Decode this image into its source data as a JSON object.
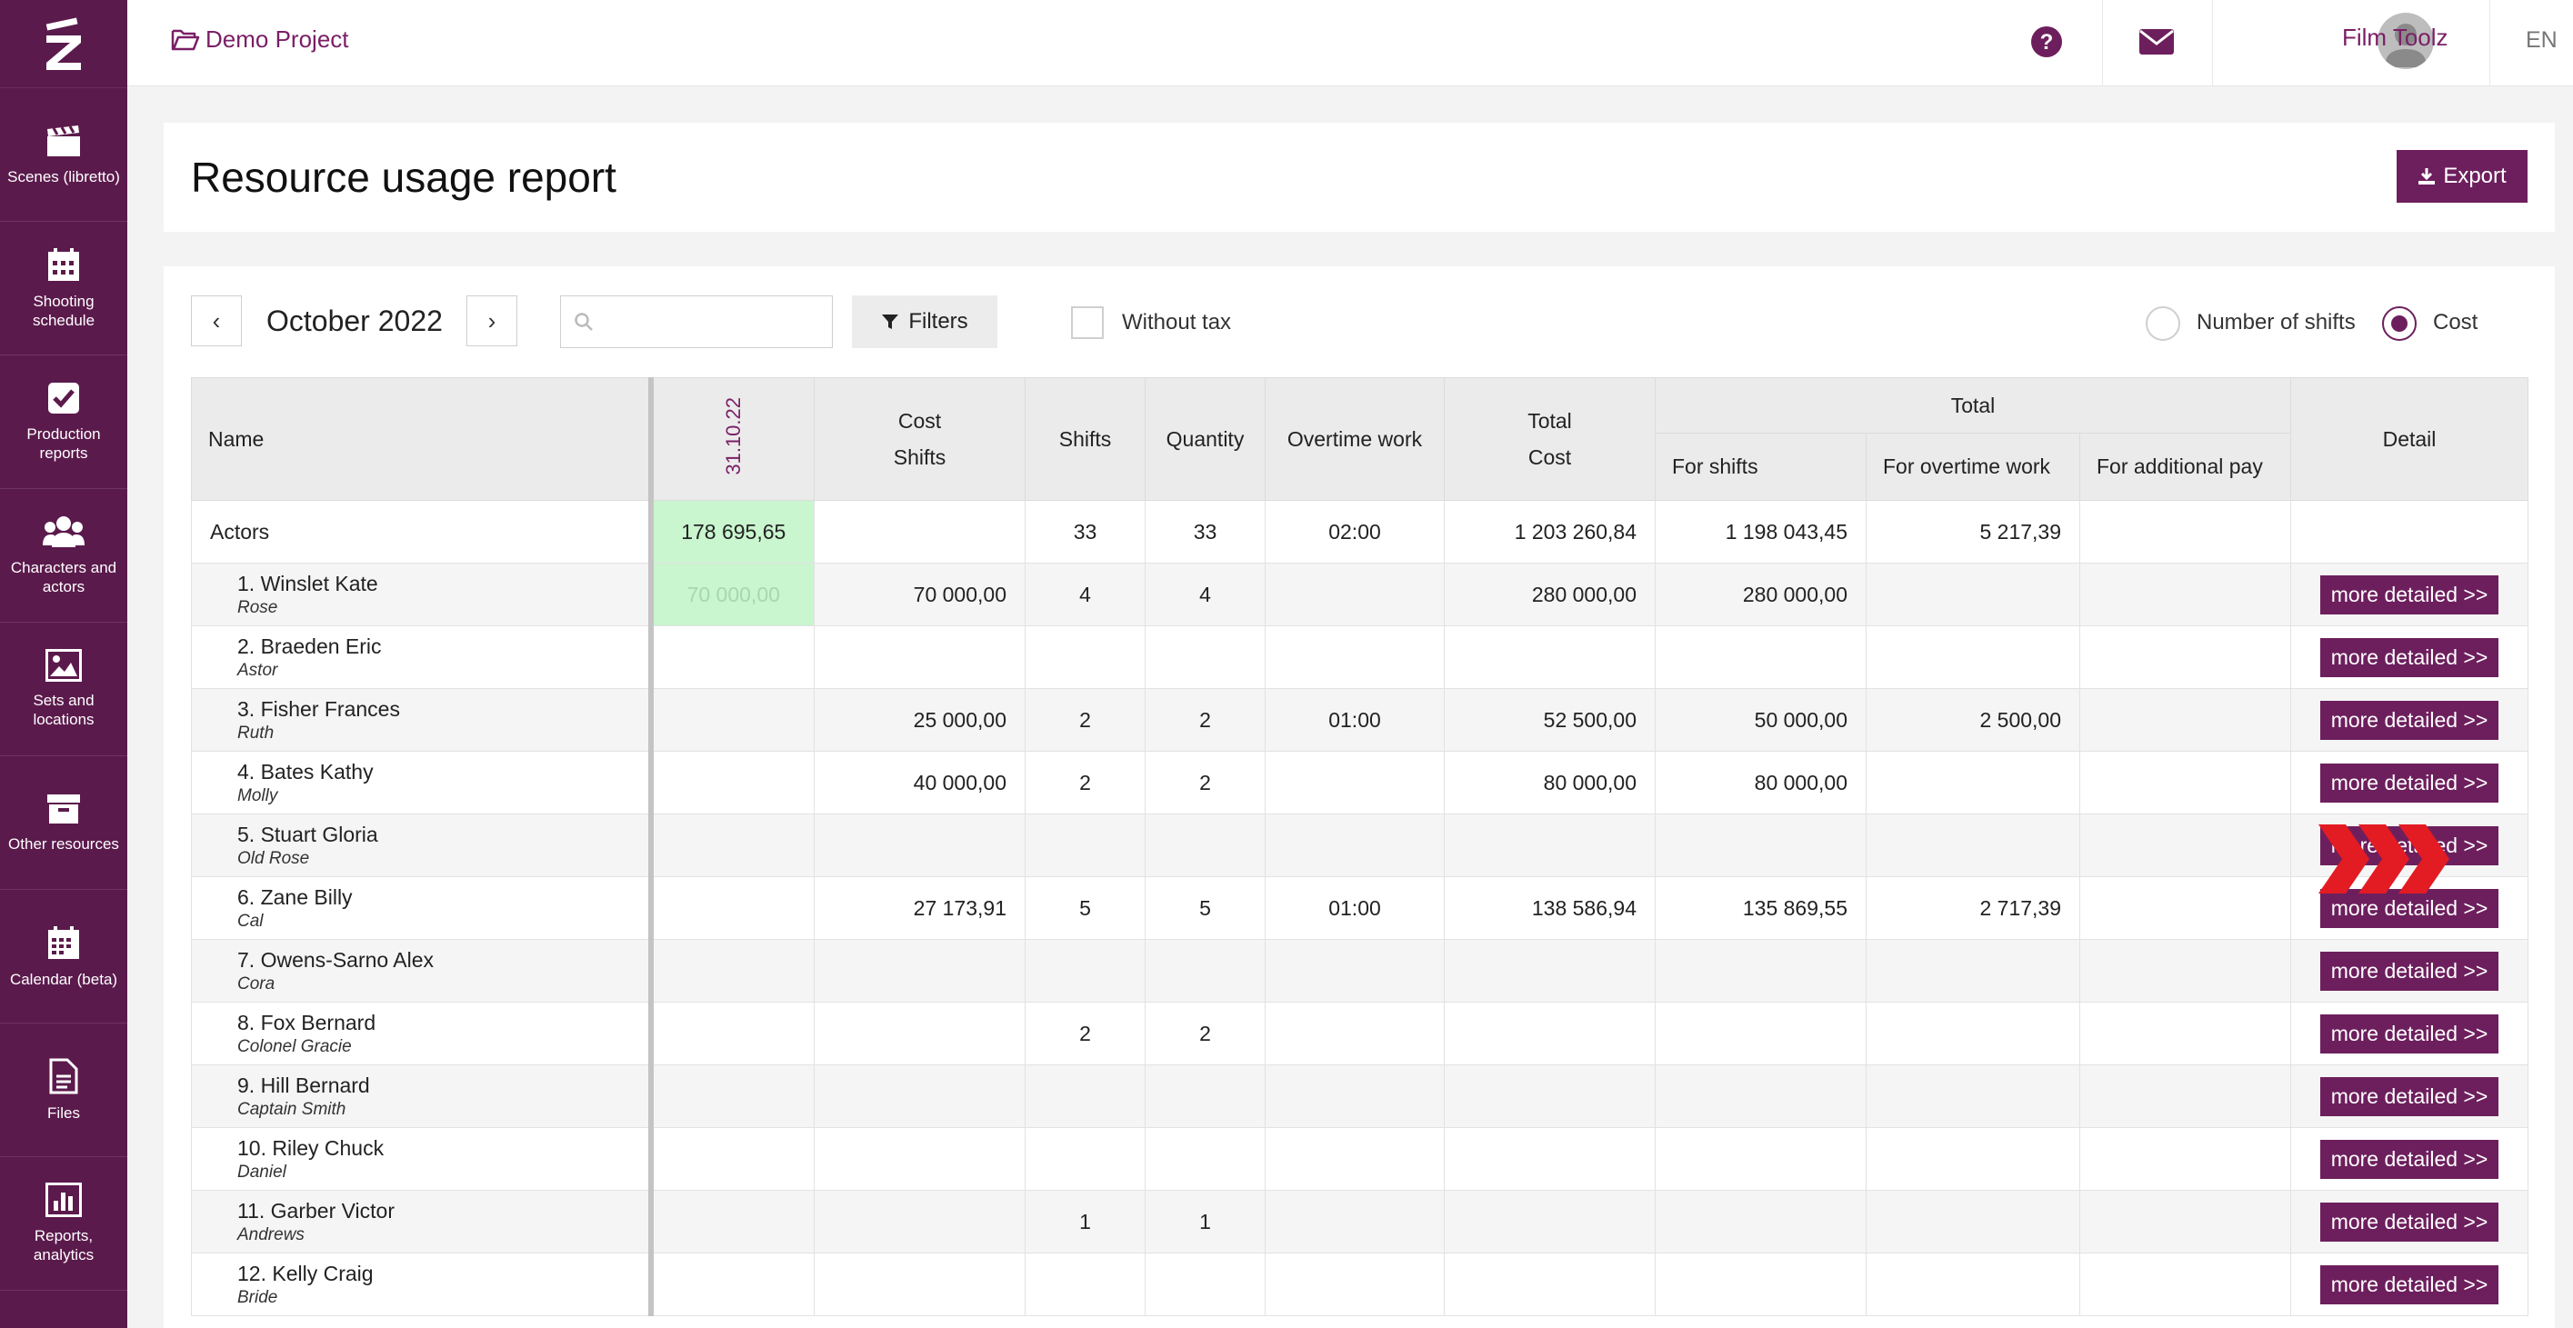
{
  "sidebar": {
    "logo_letter": "Z",
    "items": [
      {
        "label": "Scenes (libretto)",
        "icon": "clapperboard-icon"
      },
      {
        "label": "Shooting schedule",
        "icon": "calendar-icon"
      },
      {
        "label": "Production reports",
        "icon": "checkbox-icon"
      },
      {
        "label": "Characters and actors",
        "icon": "users-icon"
      },
      {
        "label": "Sets and locations",
        "icon": "image-icon"
      },
      {
        "label": "Other resources",
        "icon": "archive-box-icon"
      },
      {
        "label": "Calendar (beta)",
        "icon": "calendar-grid-icon"
      },
      {
        "label": "Files",
        "icon": "file-icon"
      },
      {
        "label": "Reports, analytics",
        "icon": "bar-chart-icon"
      }
    ]
  },
  "topbar": {
    "project": "Demo Project",
    "user": "Film Toolz",
    "language": "EN"
  },
  "page": {
    "title": "Resource usage report",
    "export_label": "Export"
  },
  "toolbar": {
    "month": "October 2022",
    "prev": "‹",
    "next": "›",
    "search_value": "",
    "filters_label": "Filters",
    "without_tax_label": "Without tax",
    "without_tax_checked": false,
    "mode_options": [
      "Number of shifts",
      "Cost"
    ],
    "mode_selected": "Cost"
  },
  "table": {
    "headers": {
      "name": "Name",
      "date": "31.10.22",
      "cost_shifts_line1": "Cost",
      "cost_shifts_line2": "Shifts",
      "shifts": "Shifts",
      "quantity": "Quantity",
      "overtime": "Overtime work",
      "total_cost_line1": "Total",
      "total_cost_line2": "Cost",
      "total_group": "Total",
      "for_shifts": "For shifts",
      "for_overtime": "For overtime work",
      "for_additional": "For additional pay",
      "detail": "Detail"
    },
    "group": {
      "name": "Actors",
      "date_value": "178 695,65",
      "cost_shifts": "",
      "shifts": "33",
      "quantity": "33",
      "overtime": "02:00",
      "total_cost": "1 203 260,84",
      "for_shifts": "1 198 043,45",
      "for_overtime": "5 217,39",
      "for_additional": ""
    },
    "detail_label": "more detailed >>",
    "rows": [
      {
        "name": "1. Winslet Kate",
        "role": "Rose",
        "date_value": "70 000,00",
        "cost_shifts": "70 000,00",
        "shifts": "4",
        "quantity": "4",
        "overtime": "",
        "total_cost": "280 000,00",
        "for_shifts": "280 000,00",
        "for_overtime": "",
        "for_additional": ""
      },
      {
        "name": "2. Braeden Eric",
        "role": "Astor",
        "date_value": "",
        "cost_shifts": "",
        "shifts": "",
        "quantity": "",
        "overtime": "",
        "total_cost": "",
        "for_shifts": "",
        "for_overtime": "",
        "for_additional": ""
      },
      {
        "name": "3. Fisher Frances",
        "role": "Ruth",
        "date_value": "",
        "cost_shifts": "25 000,00",
        "shifts": "2",
        "quantity": "2",
        "overtime": "01:00",
        "total_cost": "52 500,00",
        "for_shifts": "50 000,00",
        "for_overtime": "2 500,00",
        "for_additional": ""
      },
      {
        "name": "4. Bates Kathy",
        "role": "Molly",
        "date_value": "",
        "cost_shifts": "40 000,00",
        "shifts": "2",
        "quantity": "2",
        "overtime": "",
        "total_cost": "80 000,00",
        "for_shifts": "80 000,00",
        "for_overtime": "",
        "for_additional": ""
      },
      {
        "name": "5. Stuart Gloria",
        "role": "Old Rose",
        "date_value": "",
        "cost_shifts": "",
        "shifts": "",
        "quantity": "",
        "overtime": "",
        "total_cost": "",
        "for_shifts": "",
        "for_overtime": "",
        "for_additional": ""
      },
      {
        "name": "6. Zane Billy",
        "role": "Cal",
        "date_value": "",
        "cost_shifts": "27 173,91",
        "shifts": "5",
        "quantity": "5",
        "overtime": "01:00",
        "total_cost": "138 586,94",
        "for_shifts": "135 869,55",
        "for_overtime": "2 717,39",
        "for_additional": ""
      },
      {
        "name": "7. Owens-Sarno Alex",
        "role": "Cora",
        "date_value": "",
        "cost_shifts": "",
        "shifts": "",
        "quantity": "",
        "overtime": "",
        "total_cost": "",
        "for_shifts": "",
        "for_overtime": "",
        "for_additional": ""
      },
      {
        "name": "8. Fox Bernard",
        "role": "Colonel Gracie",
        "date_value": "",
        "cost_shifts": "",
        "shifts": "2",
        "quantity": "2",
        "overtime": "",
        "total_cost": "",
        "for_shifts": "",
        "for_overtime": "",
        "for_additional": ""
      },
      {
        "name": "9. Hill Bernard",
        "role": "Captain Smith",
        "date_value": "",
        "cost_shifts": "",
        "shifts": "",
        "quantity": "",
        "overtime": "",
        "total_cost": "",
        "for_shifts": "",
        "for_overtime": "",
        "for_additional": ""
      },
      {
        "name": "10. Riley Chuck",
        "role": "Daniel",
        "date_value": "",
        "cost_shifts": "",
        "shifts": "",
        "quantity": "",
        "overtime": "",
        "total_cost": "",
        "for_shifts": "",
        "for_overtime": "",
        "for_additional": ""
      },
      {
        "name": "11. Garber Victor",
        "role": "Andrews",
        "date_value": "",
        "cost_shifts": "",
        "shifts": "1",
        "quantity": "1",
        "overtime": "",
        "total_cost": "",
        "for_shifts": "",
        "for_overtime": "",
        "for_additional": ""
      },
      {
        "name": "12. Kelly Craig",
        "role": "Bride",
        "date_value": "",
        "cost_shifts": "",
        "shifts": "",
        "quantity": "",
        "overtime": "",
        "total_cost": "",
        "for_shifts": "",
        "for_overtime": "",
        "for_additional": ""
      }
    ]
  },
  "colors": {
    "brand": "#6d1f5d",
    "sidebar": "#5b1a4c",
    "highlight_green": "#c9f5cf",
    "arrow_red": "#e31b23"
  }
}
